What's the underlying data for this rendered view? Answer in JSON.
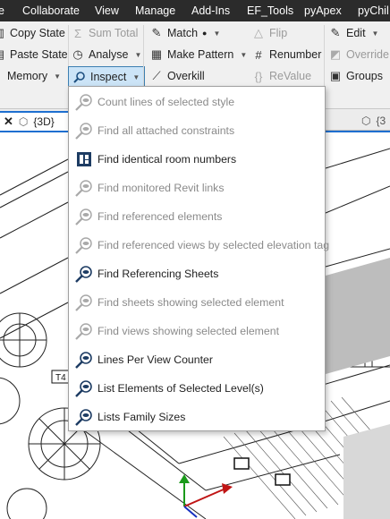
{
  "menubar": {
    "items": [
      "e",
      "Collaborate",
      "View",
      "Manage",
      "Add-Ins",
      "EF_Tools",
      "pyApex",
      "pyChil"
    ]
  },
  "ribbon": {
    "copy_state": "Copy State",
    "paste_state": "Paste State",
    "memory": "Memory",
    "sum_total": "Sum Total",
    "analyse": "Analyse",
    "inspect": "Inspect",
    "match": "Match",
    "make_pattern": "Make Pattern",
    "overkill": "Overkill",
    "flip": "Flip",
    "renumber": "Renumber",
    "revalue": "ReValue",
    "edit": "Edit",
    "override": "Override",
    "groups": "Groups"
  },
  "tabs": {
    "active_label": "{3D}",
    "second_label": "{3"
  },
  "canvas": {
    "tag_label": "T4"
  },
  "dropdown": {
    "items": [
      {
        "label": "Count lines of selected style",
        "enabled": false
      },
      {
        "label": "Find all attached constraints",
        "enabled": false
      },
      {
        "label": "Find identical room numbers",
        "enabled": true
      },
      {
        "label": "Find monitored Revit links",
        "enabled": false
      },
      {
        "label": "Find referenced elements",
        "enabled": false
      },
      {
        "label": "Find referenced views by selected elevation tag",
        "enabled": false
      },
      {
        "label": "Find Referencing Sheets",
        "enabled": true
      },
      {
        "label": "Find sheets showing selected element",
        "enabled": false
      },
      {
        "label": "Find views showing selected element",
        "enabled": false
      },
      {
        "label": "Lines Per View Counter",
        "enabled": true
      },
      {
        "label": "List Elements of Selected Level(s)",
        "enabled": true
      },
      {
        "label": "Lists Family Sizes",
        "enabled": true
      }
    ]
  },
  "colors": {
    "menubar_bg": "#2b2b2b",
    "ribbon_bg": "#f0f0f0",
    "accent_blue": "#1e6fd0",
    "inspect_highlight": "#cce4f7",
    "disabled_text": "#8a8a8a"
  }
}
